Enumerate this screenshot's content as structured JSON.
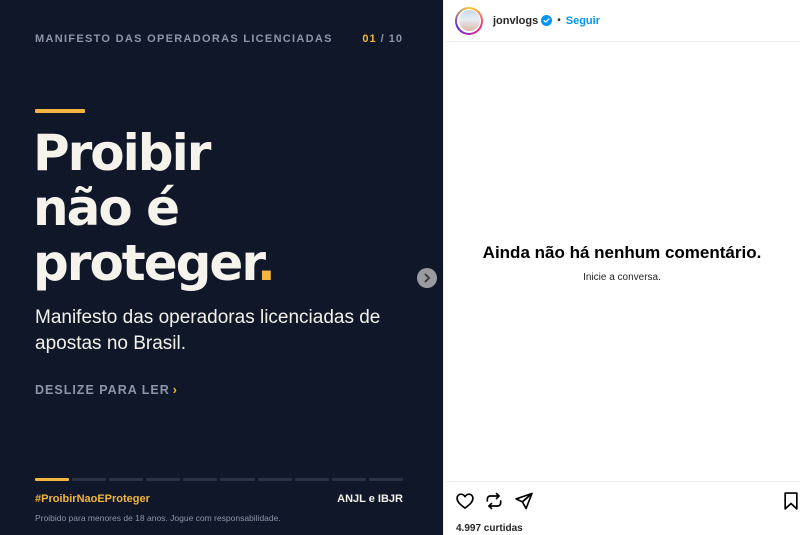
{
  "slide": {
    "kicker": "MANIFESTO DAS OPERADORAS LICENCIADAS",
    "counter_current": "01",
    "counter_total": "/ 10",
    "headline_line1": "Proibir",
    "headline_line2": "não é",
    "headline_line3": "proteger",
    "headline_dot": ".",
    "subhead": "Manifesto das operadoras licenciadas de apostas no Brasil.",
    "cta_label": "DESLIZE PARA LER",
    "cta_chevron": "›",
    "hashtag": "#ProibirNaoEProteger",
    "orgs": "ANJL e IBJR",
    "disclaimer": "Proibido para menores de 18 anos. Jogue com responsabilidade.",
    "progress_segments": 10,
    "progress_active_index": 0
  },
  "post": {
    "username": "jonvlogs",
    "separator": "•",
    "follow_label": "Seguir",
    "empty_title": "Ainda não há nenhum comentário.",
    "empty_subtitle": "Inicie a conversa.",
    "likes": "4.997 curtidas"
  },
  "icons": {
    "next": "chevron-right-icon",
    "like": "heart-icon",
    "repost": "repost-icon",
    "share": "send-icon",
    "save": "bookmark-icon",
    "verified": "verified-badge-icon"
  },
  "colors": {
    "slide_bg": "#0f1729",
    "accent": "#f2b640",
    "link": "#0095f6",
    "verified": "#0095f6"
  }
}
